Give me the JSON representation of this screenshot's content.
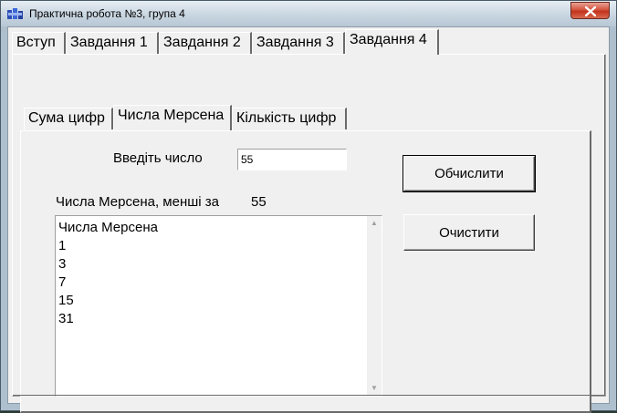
{
  "window": {
    "title": "Практична робота №3, група 4",
    "icons": {
      "app": "app-icon",
      "close": "close-icon"
    }
  },
  "main_tabs": [
    {
      "label": "Вступ"
    },
    {
      "label": "Завдання 1"
    },
    {
      "label": "Завдання 2"
    },
    {
      "label": "Завдання 3"
    },
    {
      "label": "Завдання 4",
      "active": true
    }
  ],
  "sub_tabs": [
    {
      "label": "Сума цифр"
    },
    {
      "label": "Числа Мерсена",
      "active": true
    },
    {
      "label": "Кількість цифр"
    }
  ],
  "form": {
    "input_label": "Введіть число",
    "input_value": "55",
    "result_label": "Числа Мерсена, менші за",
    "result_value": "55",
    "list_lines": [
      "Числа Мерсена",
      "1",
      "3",
      "7",
      "15",
      "31"
    ]
  },
  "buttons": {
    "calculate": "Обчислити",
    "clear": "Очистити"
  },
  "colors": {
    "face": "#f0f0f0",
    "close_button": "#c2321c",
    "titlebar": "#c9d6e1"
  }
}
